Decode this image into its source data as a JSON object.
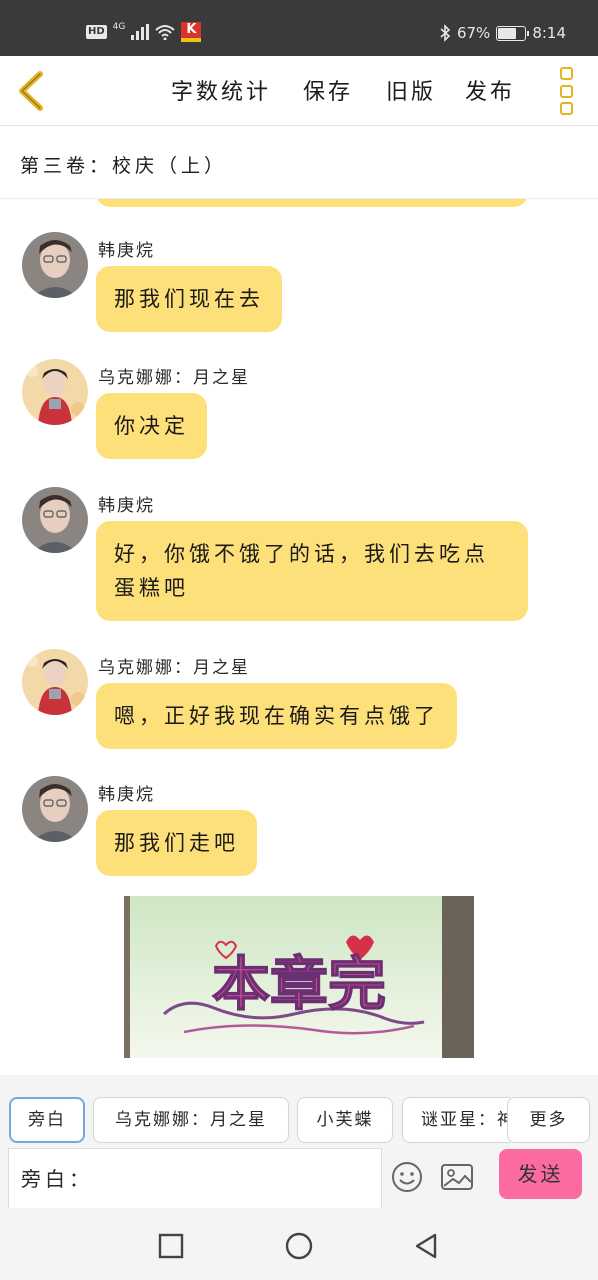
{
  "status_bar": {
    "hd": "HD",
    "network": "4G",
    "app_badge": "K",
    "battery_percent": "67%",
    "battery_level": 0.67,
    "time": "8:14"
  },
  "toolbar": {
    "back_icon": "chevron-left-icon",
    "items": [
      "字数统计",
      "保存",
      "旧版",
      "发布"
    ],
    "menu_icon": "more-vertical-icon",
    "accent_color": "#e4b321"
  },
  "chapter": {
    "title": "第三卷：校庆（上）"
  },
  "messages": [
    {
      "sender": "韩庚烷",
      "lines": [
        "那我们现在去"
      ]
    },
    {
      "sender": "乌克娜娜：月之星",
      "lines": [
        "你决定"
      ]
    },
    {
      "sender": "韩庚烷",
      "lines": [
        "好，你饿不饿了的话，我们去吃点",
        "蛋糕吧"
      ]
    },
    {
      "sender": "乌克娜娜：月之星",
      "lines": [
        "嗯，正好我现在确实有点饿了"
      ]
    },
    {
      "sender": "韩庚烷",
      "lines": [
        "那我们走吧"
      ]
    }
  ],
  "end_image": {
    "text": "本章完"
  },
  "composer": {
    "roles": [
      "旁白",
      "乌克娜娜：月之星",
      "小芙蝶",
      "谜亚星：神"
    ],
    "active_role": "旁白",
    "more_label": "更多",
    "input_placeholder": "旁白：",
    "send_label": "发送",
    "bubble_color": "#fde07a",
    "send_color": "#fb6aa0"
  },
  "navbar": {
    "icons": [
      "square-recent-icon",
      "circle-home-icon",
      "triangle-back-icon"
    ]
  }
}
